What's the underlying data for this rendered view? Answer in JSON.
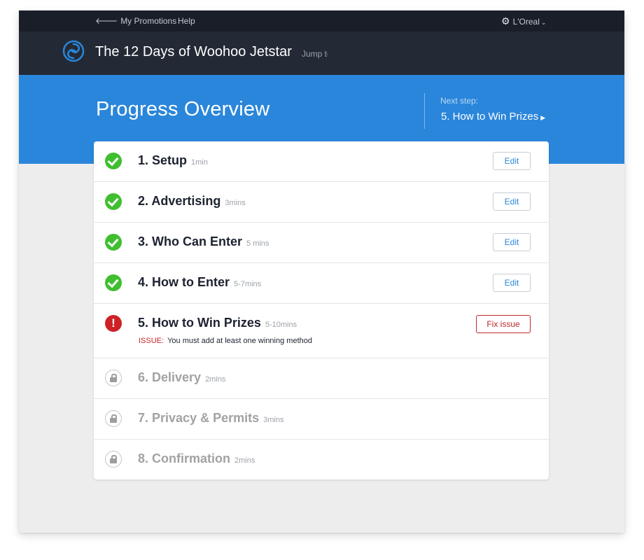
{
  "topnav": {
    "back_arrow": "🡐",
    "my_promotions": "My Promotions",
    "help": "Help",
    "account_name": "L'Oreal",
    "gear_icon": "⚙",
    "caret": "⌄"
  },
  "titlebar": {
    "promotion_title": "The 12 Days of Woohoo Jetstar",
    "jump_to": "Jump to"
  },
  "hero": {
    "page_title": "Progress Overview",
    "next_step_label": "Next step:",
    "next_step_link": "5. How to Win Prizes",
    "next_step_arrow": "▶"
  },
  "steps": [
    {
      "title": "1. Setup",
      "duration": "1min",
      "status": "done",
      "action": "Edit"
    },
    {
      "title": "2. Advertising",
      "duration": "3mins",
      "status": "done",
      "action": "Edit"
    },
    {
      "title": "3. Who Can Enter",
      "duration": "5 mins",
      "status": "done",
      "action": "Edit"
    },
    {
      "title": "4. How to Enter",
      "duration": "5-7mins",
      "status": "done",
      "action": "Edit"
    },
    {
      "title": "5. How to Win Prizes",
      "duration": "5-10mins",
      "status": "error",
      "action": "Fix issue",
      "issue_label": "ISSUE:",
      "issue_text": "You must add at least one winning method",
      "error_glyph": "!"
    },
    {
      "title": "6. Delivery",
      "duration": "2mins",
      "status": "locked"
    },
    {
      "title": "7. Privacy & Permits",
      "duration": "3mins",
      "status": "locked"
    },
    {
      "title": "8. Confirmation",
      "duration": "2mins",
      "status": "locked"
    }
  ],
  "colors": {
    "topnav_bg": "#191e28",
    "titlebar_bg": "#232a36",
    "hero_bg": "#2a86da",
    "done": "#3fbf2f",
    "error": "#c4262b",
    "link": "#2a86da"
  },
  "icons": {
    "logo": "swirl-logo-icon",
    "done": "checkmark-circle-icon",
    "error": "exclamation-circle-icon",
    "locked": "lock-circle-icon"
  }
}
